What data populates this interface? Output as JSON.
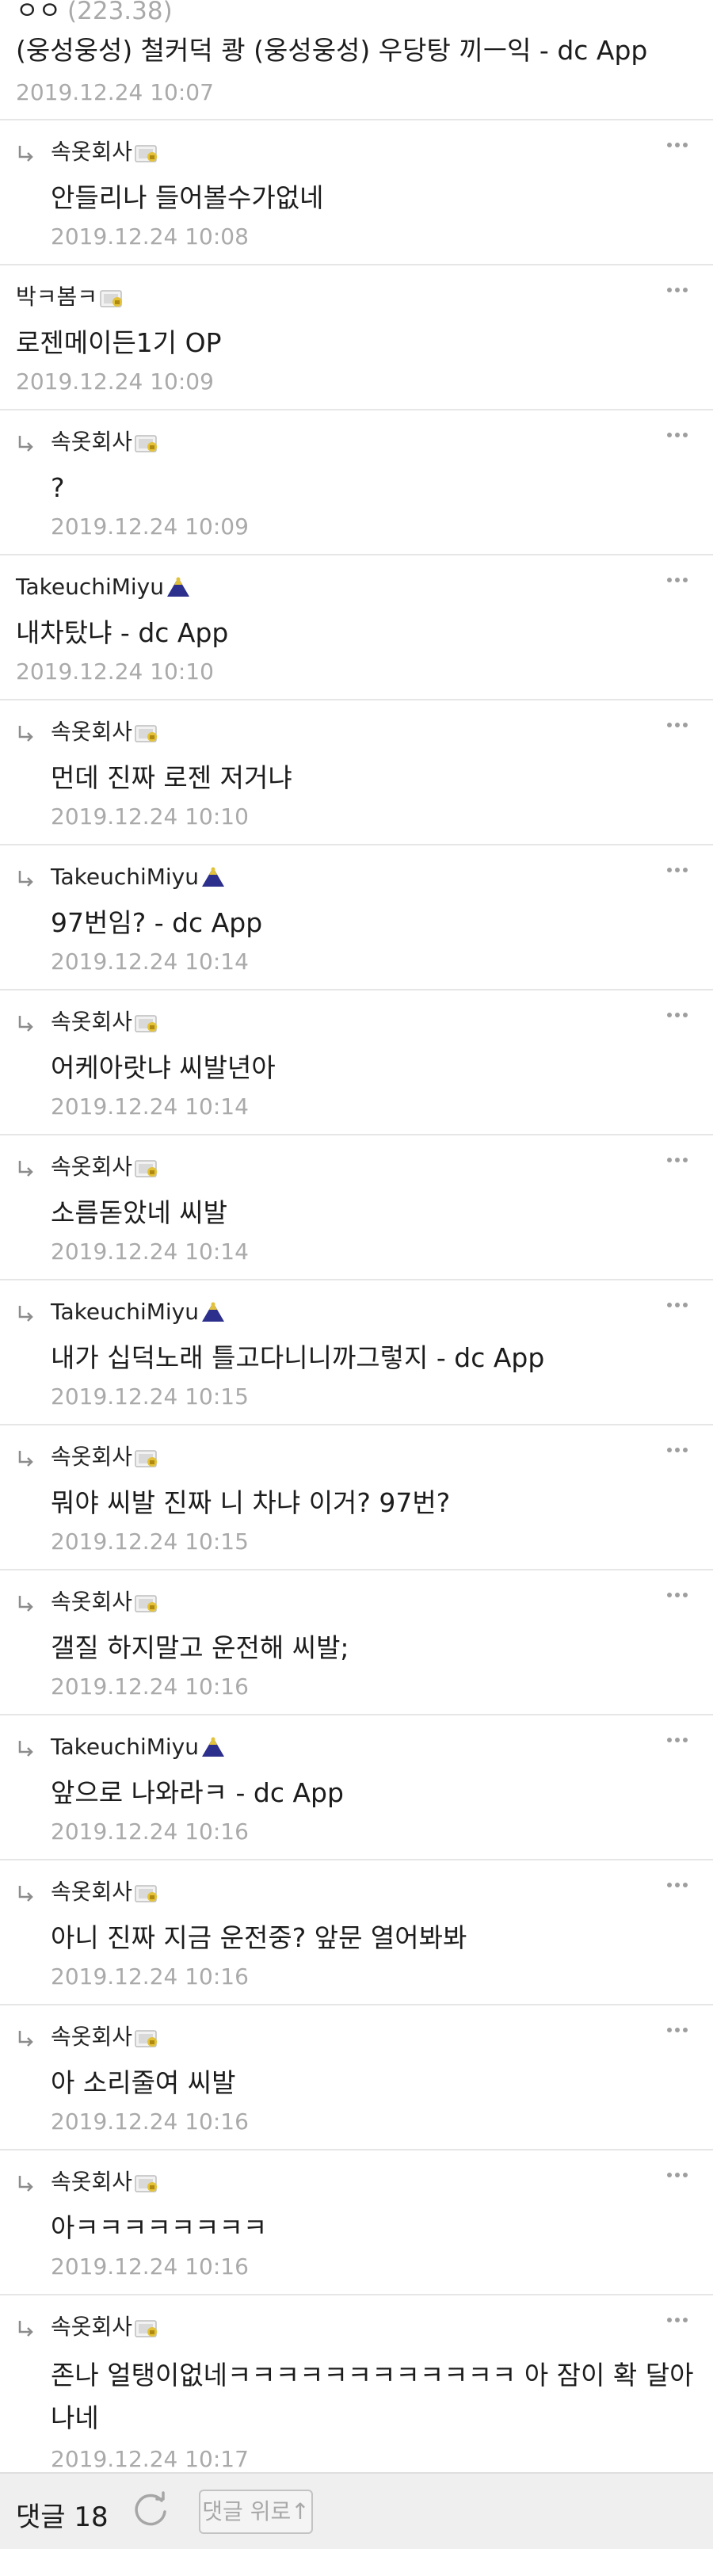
{
  "top_comment": {
    "dots": "ㅇㅇ",
    "ip": "(223.38)",
    "body": "(웅성웅성) 철커덕 쾅 (웅성웅성) 우당탕 끼ㅡ익  - dc App",
    "time": "2019.12.24 10:07"
  },
  "comments": [
    {
      "reply": true,
      "author": "속옷회사",
      "badge": "lock",
      "body": "안들리나 들어볼수가없네",
      "time": "2019.12.24 10:08"
    },
    {
      "reply": false,
      "author": "박ㅋ봄ㅋ",
      "badge": "lock",
      "body": "로젠메이든1기 OP",
      "time": "2019.12.24 10:09"
    },
    {
      "reply": true,
      "author": "속옷회사",
      "badge": "lock",
      "body": "?",
      "time": "2019.12.24 10:09"
    },
    {
      "reply": false,
      "author": "TakeuchiMiyu",
      "badge": "mountain",
      "body": "내차탔냐  - dc App",
      "time": "2019.12.24 10:10"
    },
    {
      "reply": true,
      "author": "속옷회사",
      "badge": "lock",
      "body": "먼데 진짜 로젠 저거냐",
      "time": "2019.12.24 10:10"
    },
    {
      "reply": true,
      "author": "TakeuchiMiyu",
      "badge": "mountain",
      "body": "97번임?  - dc App",
      "time": "2019.12.24 10:14"
    },
    {
      "reply": true,
      "author": "속옷회사",
      "badge": "lock",
      "body": "어케아랏냐 씨발년아",
      "time": "2019.12.24 10:14"
    },
    {
      "reply": true,
      "author": "속옷회사",
      "badge": "lock",
      "body": "소름돋았네 씨발",
      "time": "2019.12.24 10:14"
    },
    {
      "reply": true,
      "author": "TakeuchiMiyu",
      "badge": "mountain",
      "body": "내가 십덕노래 틀고다니니까그렇지  - dc App",
      "time": "2019.12.24 10:15"
    },
    {
      "reply": true,
      "author": "속옷회사",
      "badge": "lock",
      "body": "뭐야 씨발 진짜 니 차냐 이거? 97번?",
      "time": "2019.12.24 10:15"
    },
    {
      "reply": true,
      "author": "속옷회사",
      "badge": "lock",
      "body": "갤질 하지말고 운전해 씨발;",
      "time": "2019.12.24 10:16"
    },
    {
      "reply": true,
      "author": "TakeuchiMiyu",
      "badge": "mountain",
      "body": "앞으로 나와라ㅋ  - dc App",
      "time": "2019.12.24 10:16"
    },
    {
      "reply": true,
      "author": "속옷회사",
      "badge": "lock",
      "body": "아니 진짜 지금 운전중? 앞문 열어봐봐",
      "time": "2019.12.24 10:16"
    },
    {
      "reply": true,
      "author": "속옷회사",
      "badge": "lock",
      "body": "아 소리줄여 씨발",
      "time": "2019.12.24 10:16"
    },
    {
      "reply": true,
      "author": "속옷회사",
      "badge": "lock",
      "body": "아ㅋㅋㅋㅋㅋㅋㅋㅋ",
      "time": "2019.12.24 10:16"
    },
    {
      "reply": true,
      "author": "속옷회사",
      "badge": "lock",
      "body": "존나 얼탱이없네ㅋㅋㅋㅋㅋㅋㅋㅋㅋㅋㅋㅋ 아 잠이 확 달아나네",
      "time": "2019.12.24 10:17",
      "multiline": true
    }
  ],
  "footer": {
    "comment_count_label": "댓글 18",
    "refresh_icon": "refresh-icon",
    "scroll_top_label": "댓글 위로↑"
  },
  "colors": {
    "timestamp": "#aaaaaa",
    "divider": "#e6e6e6",
    "footer_bg": "#efefef",
    "lock_badge": "#e3c23a",
    "mountain_badge": "#2c2f8c"
  }
}
